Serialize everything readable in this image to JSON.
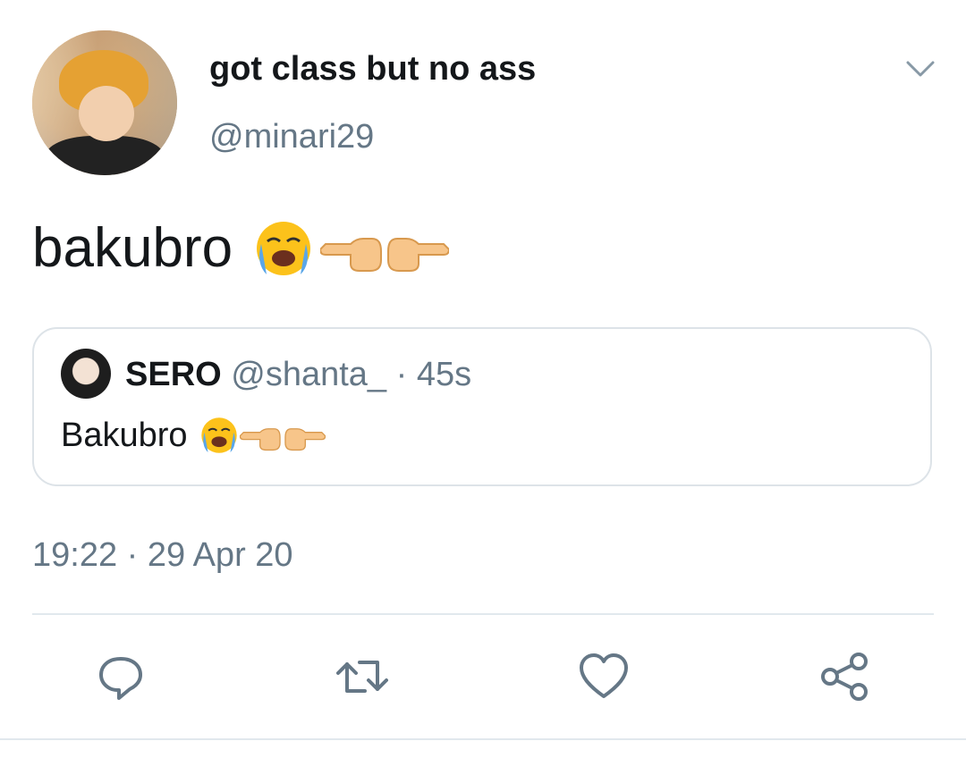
{
  "tweet": {
    "display_name": "got class but no ass",
    "handle": "@minari29",
    "text": "bakubro",
    "emojis": [
      "loudly-crying-face",
      "backhand-index-pointing-left",
      "backhand-index-pointing-right"
    ],
    "timestamp": "19:22 · 29 Apr 20"
  },
  "quoted": {
    "name": "SERO",
    "meta": "@shanta_ · 45s",
    "text": "Bakubro",
    "emojis": [
      "loudly-crying-face",
      "backhand-index-pointing-left",
      "backhand-index-pointing-right"
    ]
  },
  "actions": [
    "reply-icon",
    "retweet-icon",
    "like-icon",
    "share-icon"
  ],
  "colors": {
    "text": "#14171a",
    "secondary": "#657786",
    "icon": "#657786",
    "border": "#dde3e8"
  }
}
